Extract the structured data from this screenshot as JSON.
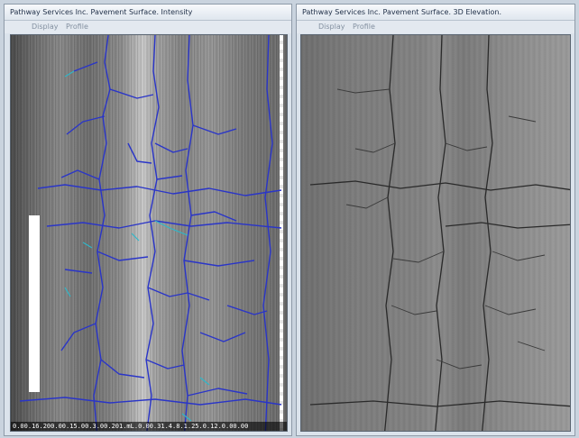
{
  "left_window": {
    "title": "Pathway Services Inc. Pavement Surface. Intensity",
    "menu": [
      "Display",
      "Profile"
    ],
    "scale_readout": "0.00.16.200.00.15.00.3.00.201.mL.0.00.31.4.8.1.25.0.12.0.00.00"
  },
  "right_window": {
    "title": "Pathway Services Inc. Pavement Surface. 3D Elevation.",
    "menu": [
      "Display",
      "Profile"
    ]
  },
  "colors": {
    "crack_overlay": "#2a35c8",
    "crack_highlight": "#2fb7c9",
    "window_bg": "#dbe3ec"
  },
  "icons": []
}
